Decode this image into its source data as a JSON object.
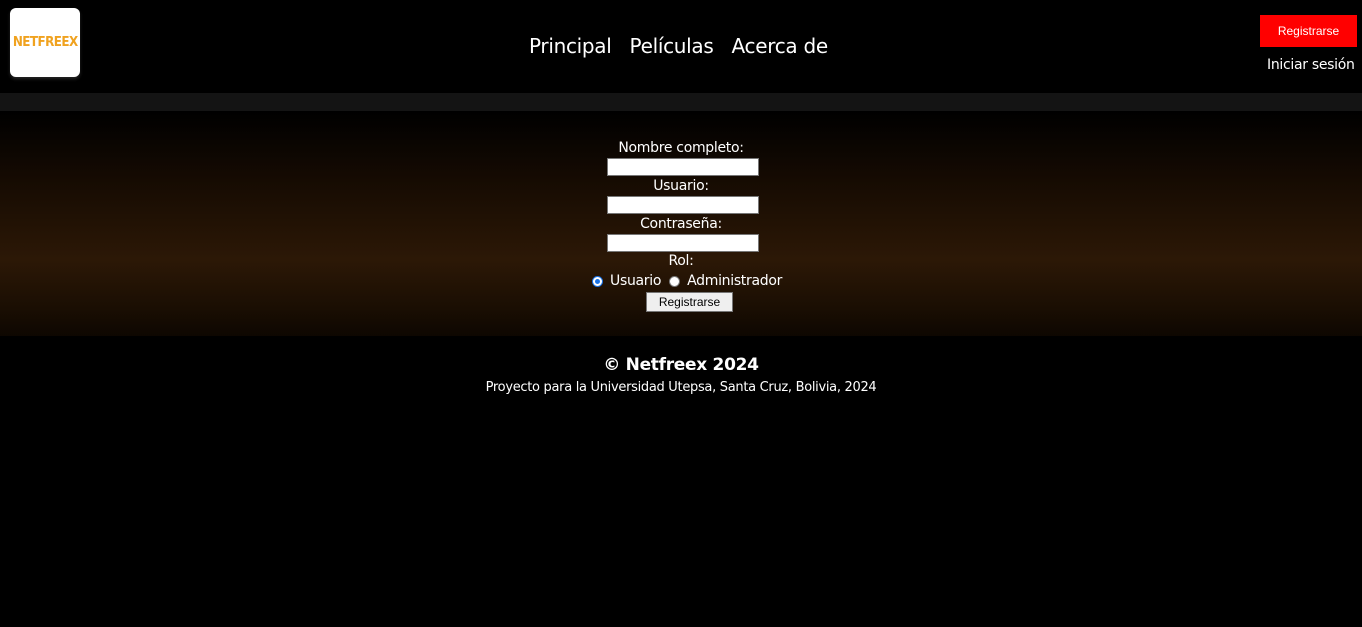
{
  "brand": {
    "logo_text": "NETFREEX",
    "logo_color": "#f0a21f"
  },
  "nav": {
    "items": [
      {
        "label": "Principal"
      },
      {
        "label": "Películas"
      },
      {
        "label": "Acerca de"
      }
    ]
  },
  "header": {
    "register_label": "Registrarse",
    "login_label": "Iniciar sesión",
    "accent_color": "#ff0000"
  },
  "form": {
    "fullname_label": "Nombre completo:",
    "fullname_value": "",
    "username_label": "Usuario:",
    "username_value": "",
    "password_label": "Contraseña:",
    "password_value": "",
    "role_label": "Rol:",
    "role_options": [
      {
        "label": "Usuario",
        "selected": true
      },
      {
        "label": "Administrador",
        "selected": false
      }
    ],
    "submit_label": "Registrarse"
  },
  "footer": {
    "title": "© Netfreex 2024",
    "subtitle": "Proyecto para la Universidad Utepsa, Santa Cruz, Bolivia, 2024"
  }
}
